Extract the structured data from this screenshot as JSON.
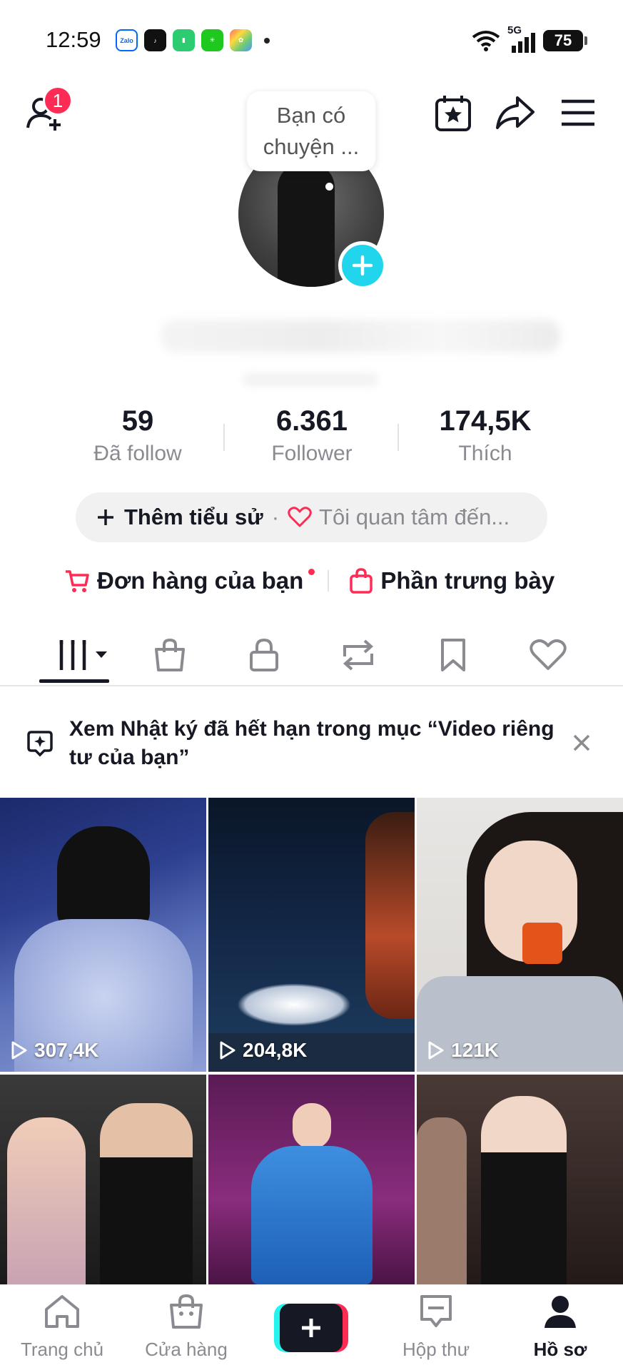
{
  "status_bar": {
    "time": "12:59",
    "apps": [
      "Zalo",
      "TikTok",
      "app-green-1",
      "app-green-2",
      "app-multicolor"
    ],
    "network": "5G",
    "battery": "75"
  },
  "header": {
    "friend_badge": "1",
    "note": "Bạn có chuyện ..."
  },
  "stats": [
    {
      "value": "59",
      "label": "Đã follow"
    },
    {
      "value": "6.361",
      "label": "Follower"
    },
    {
      "value": "174,5K",
      "label": "Thích"
    }
  ],
  "bio": {
    "add_label": "Thêm tiểu sử",
    "separator": "·",
    "interest_label": "Tôi quan tâm đến..."
  },
  "shop": {
    "orders_label": "Đơn hàng của bạn",
    "showcase_label": "Phần trưng bày"
  },
  "notice": {
    "text": "Xem Nhật ký đã hết hạn trong mục “Video riêng tư của bạn”"
  },
  "videos": [
    {
      "views": "307,4K"
    },
    {
      "views": "204,8K"
    },
    {
      "views": "121K"
    },
    {
      "views": ""
    },
    {
      "views": ""
    },
    {
      "views": ""
    }
  ],
  "bottom_nav": [
    {
      "label": "Trang chủ"
    },
    {
      "label": "Cửa hàng"
    },
    {
      "label": ""
    },
    {
      "label": "Hộp thư"
    },
    {
      "label": "Hồ sơ"
    }
  ],
  "colors": {
    "accent_red": "#fe2c55",
    "accent_cyan": "#20d5ec",
    "text_primary": "#161823",
    "text_secondary": "#8a8b91"
  }
}
